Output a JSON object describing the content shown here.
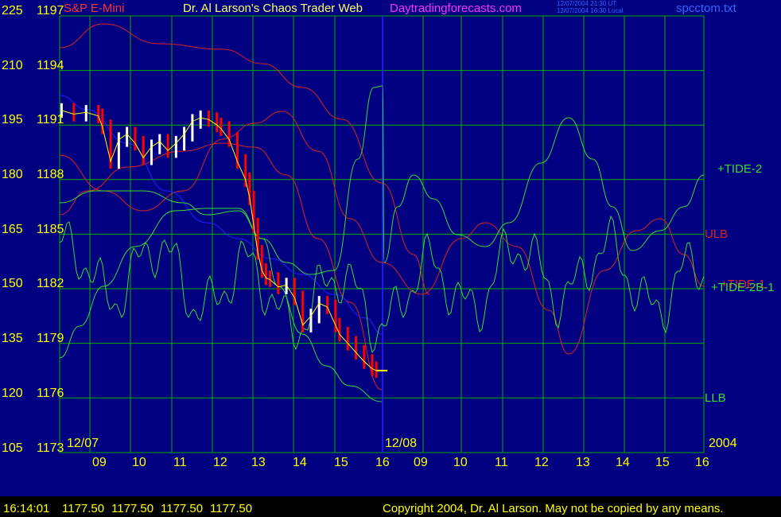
{
  "header": {
    "instrument": "S&P E-Mini",
    "site_title": "Dr. Al Larson's Chaos Trader Web",
    "site_url": "Daytradingforecasts.com",
    "timestamp_ut": "12/07/2004 21:30 UT",
    "timestamp_local": "12/07/2004 16:30 Local",
    "file_name": "spcctom.txt"
  },
  "colors": {
    "background": "#000080",
    "grid": "#00b000",
    "tick_labels": "#ffff00",
    "title": "#ffff66",
    "instrument": "#ff3333",
    "url": "#ff33ff",
    "small_text": "#3366ff",
    "price_up": "#ffffff",
    "price_down": "#ff0000",
    "average": "#ffff00",
    "forecast_green": "#33dd33",
    "forecast_red": "#dd2222",
    "forecast_blue": "#2222ff"
  },
  "chart_data": {
    "type": "line",
    "title": "S&P E-Mini",
    "grid": true,
    "y_left_labels": [
      "225",
      "210",
      "195",
      "180",
      "165",
      "150",
      "135",
      "120",
      "105"
    ],
    "y_right_labels": [
      "1197",
      "1194",
      "1191",
      "1188",
      "1185",
      "1182",
      "1179",
      "1176",
      "1173"
    ],
    "ylim": [
      1173,
      1197
    ],
    "y2lim": [
      105,
      225
    ],
    "x_hour_labels": [
      "09",
      "10",
      "11",
      "12",
      "13",
      "14",
      "15",
      "16",
      "09",
      "10",
      "11",
      "12",
      "13",
      "14",
      "15",
      "16"
    ],
    "date_labels": [
      "12/07",
      "12/08"
    ],
    "year_label": "2004",
    "price_series": {
      "name": "S&P E-Mini price",
      "x_hours": [
        8.3,
        8.6,
        8.9,
        9.2,
        9.3,
        9.5,
        9.7,
        9.9,
        10.1,
        10.3,
        10.5,
        10.7,
        10.9,
        11.1,
        11.3,
        11.5,
        11.7,
        11.9,
        12.1,
        12.2,
        12.4,
        12.6,
        12.8,
        12.9,
        13.0,
        13.1,
        13.2,
        13.3,
        13.4,
        13.6,
        13.8,
        14.0,
        14.2,
        14.4,
        14.6,
        14.8,
        15.0,
        15.1,
        15.3,
        15.5,
        15.7,
        15.9,
        16.0
      ],
      "values": [
        1191.8,
        1191.6,
        1191.7,
        1191.5,
        1190.9,
        1189.0,
        1190.2,
        1190.5,
        1190.0,
        1189.2,
        1189.8,
        1190.1,
        1189.6,
        1190.0,
        1190.5,
        1191.2,
        1191.4,
        1191.3,
        1191.0,
        1190.8,
        1190.2,
        1189.0,
        1188.0,
        1187.0,
        1185.5,
        1184.0,
        1183.0,
        1182.6,
        1182.5,
        1182.1,
        1182.2,
        1181.5,
        1180.0,
        1180.5,
        1181.2,
        1181.0,
        1180.0,
        1179.5,
        1179.0,
        1178.5,
        1178.0,
        1177.6,
        1177.5
      ]
    },
    "series": [
      {
        "name": "+TIDE-2",
        "color": "#33dd33",
        "label_value": 1188.0
      },
      {
        "name": "ULB",
        "color": "#dd2222",
        "label_value": 1185.0
      },
      {
        "name": "+TIDE-1",
        "color": "#33dd33",
        "label_value": 1182.0
      },
      {
        "name": "+TIDE-2B-1",
        "color": "#33dd33",
        "label_value": 1182.0
      },
      {
        "name": "LLB",
        "color": "#33dd33",
        "label_value": 1176.0
      }
    ]
  },
  "footer": {
    "time": "16:14:01",
    "open": "1177.50",
    "high": "1177.50",
    "low": "1177.50",
    "close": "1177.50",
    "copyright": "Copyright 2004, Dr. Al Larson. May not be copied by any means."
  }
}
